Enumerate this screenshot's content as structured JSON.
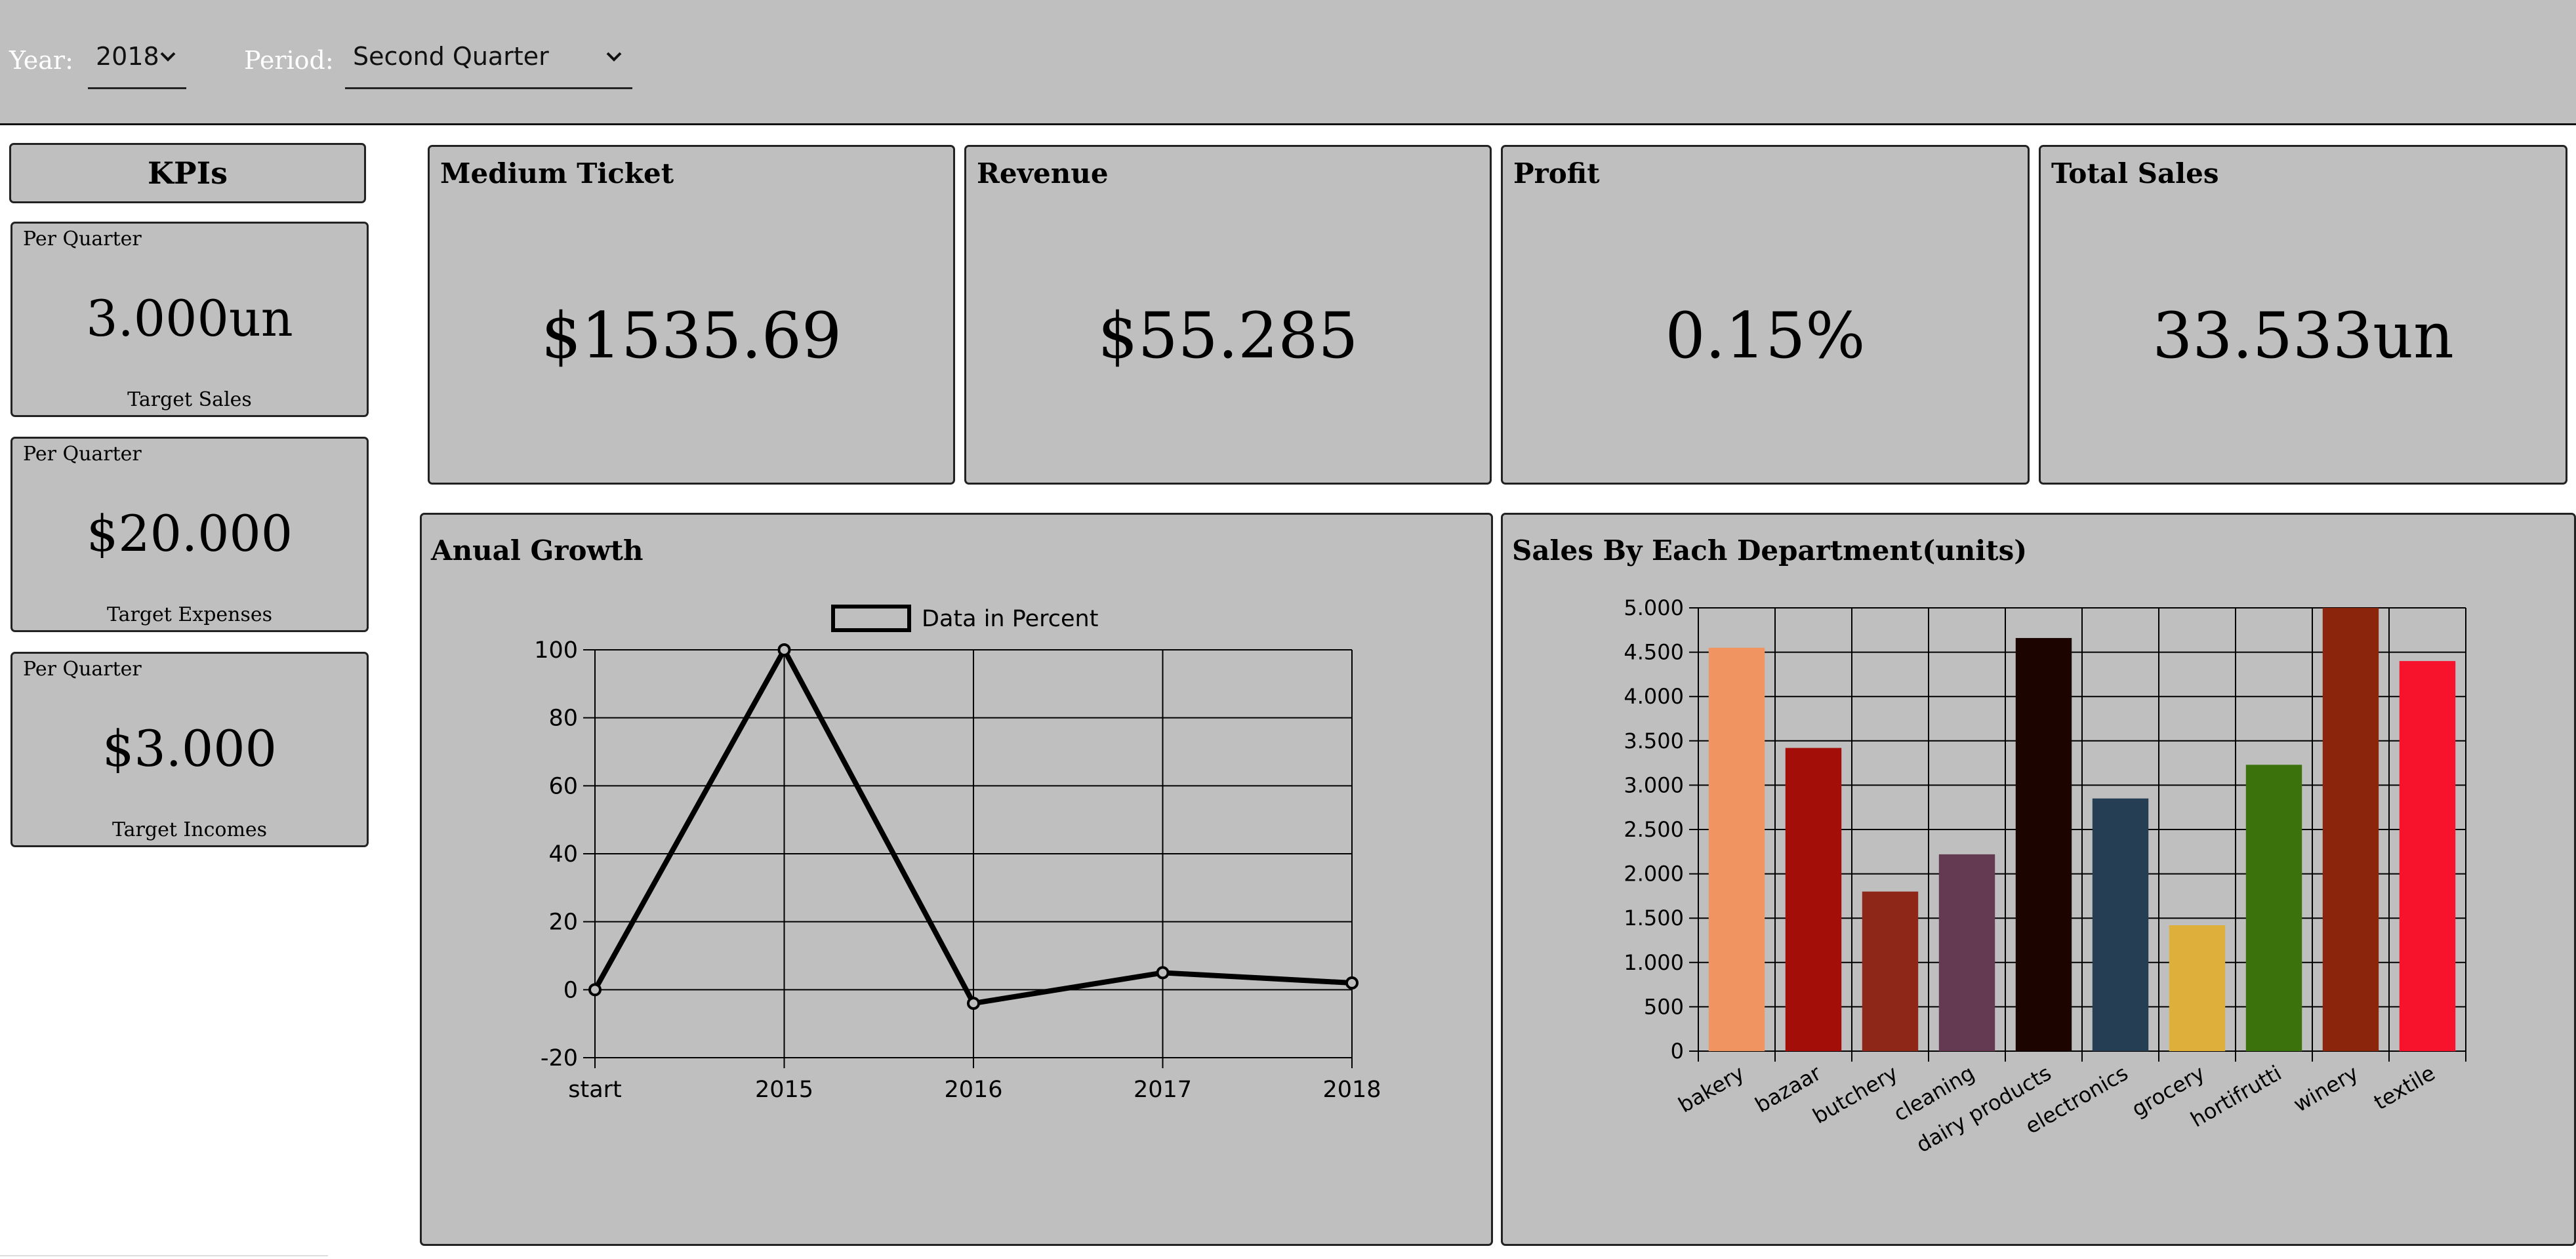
{
  "filters": {
    "year_label": "Year:",
    "year_value": "2018",
    "period_label": "Period:",
    "period_value": "Second Quarter"
  },
  "sidebar": {
    "title": "KPIs",
    "cards": [
      {
        "top": "Per Quarter",
        "value": "3.000un",
        "bottom": "Target Sales"
      },
      {
        "top": "Per Quarter",
        "value": "$20.000",
        "bottom": "Target Expenses"
      },
      {
        "top": "Per Quarter",
        "value": "$3.000",
        "bottom": "Target Incomes"
      }
    ]
  },
  "cards": [
    {
      "title": "Medium Ticket",
      "value": "$1535.69"
    },
    {
      "title": "Revenue",
      "value": "$55.285"
    },
    {
      "title": "Profit",
      "value": "0.15%"
    },
    {
      "title": "Total Sales",
      "value": "33.533un"
    }
  ],
  "chart_data": [
    {
      "type": "line",
      "title": "Anual Growth",
      "x": [
        "start",
        "2015",
        "2016",
        "2017",
        "2018"
      ],
      "series": [
        {
          "name": "Data in Percent",
          "values": [
            0,
            100,
            -4,
            5,
            2
          ]
        }
      ],
      "ylim": [
        -20,
        100
      ],
      "yticks": [
        -20,
        0,
        20,
        40,
        60,
        80,
        100
      ],
      "legend": "top",
      "grid": true
    },
    {
      "type": "bar",
      "title": "Sales By Each Department(units)",
      "categories": [
        "bakery",
        "bazaar",
        "butchery",
        "cleaning",
        "dairy products",
        "electronics",
        "grocery",
        "hortifrutti",
        "winery",
        "textile"
      ],
      "values": [
        4550,
        3420,
        1800,
        2220,
        4660,
        2850,
        1420,
        3230,
        5000,
        4400
      ],
      "colors": [
        "#f09462",
        "#a30e08",
        "#8f2719",
        "#633a52",
        "#1c0500",
        "#263e53",
        "#deb03b",
        "#3b720b",
        "#8b260d",
        "#f7132b"
      ],
      "ylim": [
        0,
        5000
      ],
      "yticks": [
        0,
        500,
        1000,
        1500,
        2000,
        2500,
        3000,
        3500,
        4000,
        4500,
        5000
      ],
      "ytick_labels": [
        "0",
        "500",
        "1.000",
        "1.500",
        "2.000",
        "2.500",
        "3.000",
        "3.500",
        "4.000",
        "4.500",
        "5.000"
      ],
      "grid": true
    }
  ]
}
